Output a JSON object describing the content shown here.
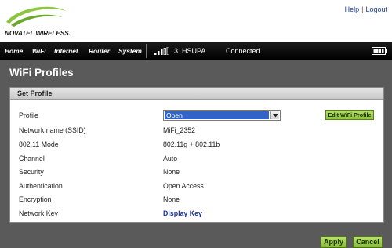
{
  "brand": {
    "logo_text": "NOVATEL WIRELESS."
  },
  "top_links": {
    "help": "Help",
    "separator": "|",
    "logout": "Logout"
  },
  "nav": {
    "items": [
      {
        "label": "Home"
      },
      {
        "label": "WiFi"
      },
      {
        "label": "Internet"
      },
      {
        "label": "Router"
      },
      {
        "label": "System"
      }
    ],
    "signal_icon": "signal-bars-icon",
    "network_count": "3",
    "network_type": "HSUPA",
    "connection_status": "Connected",
    "battery_icon": "battery-icon"
  },
  "page": {
    "title": "WiFi Profiles"
  },
  "section": {
    "title": "Set Profile"
  },
  "profile": {
    "label": "Profile",
    "selected": "Open",
    "edit_button": "Edit WiFi Profile"
  },
  "fields": [
    {
      "label": "Network name (SSID)",
      "value": "MiFi_2352"
    },
    {
      "label": "802.11 Mode",
      "value": "802.11g + 802.11b"
    },
    {
      "label": "Channel",
      "value": "Auto"
    },
    {
      "label": "Security",
      "value": "None"
    },
    {
      "label": "Authentication",
      "value": "Open Access"
    },
    {
      "label": "Encryption",
      "value": "None"
    },
    {
      "label": "Network Key",
      "value": "Display Key"
    }
  ],
  "actions": {
    "apply": "Apply",
    "cancel": "Cancel"
  },
  "colors": {
    "nav_background": "#000000",
    "panel_background": "#5a5a5a",
    "select_highlight": "#3264c8",
    "button_green": "#8cc03c",
    "link_blue": "#1a3399",
    "logo_green": "#8cc63f"
  }
}
